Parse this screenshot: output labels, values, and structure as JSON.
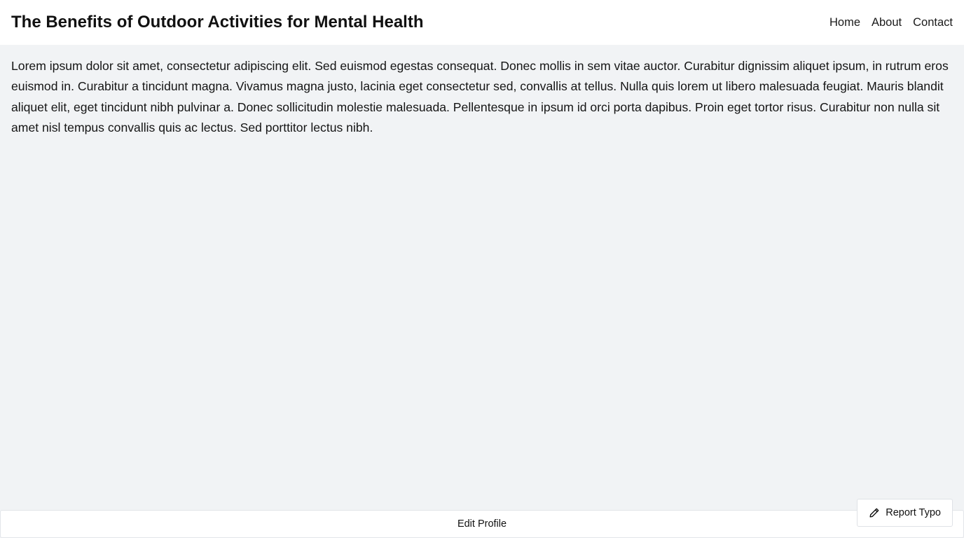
{
  "header": {
    "title": "The Benefits of Outdoor Activities for Mental Health",
    "nav": [
      "Home",
      "About",
      "Contact"
    ]
  },
  "main": {
    "body_text": "Lorem ipsum dolor sit amet, consectetur adipiscing elit. Sed euismod egestas consequat. Donec mollis in sem vitae auctor. Curabitur dignissim aliquet ipsum, in rutrum eros euismod in. Curabitur a tincidunt magna. Vivamus magna justo, lacinia eget consectetur sed, convallis at tellus. Nulla quis lorem ut libero malesuada feugiat. Mauris blandit aliquet elit, eget tincidunt nibh pulvinar a. Donec sollicitudin molestie malesuada. Pellentesque in ipsum id orci porta dapibus. Proin eget tortor risus. Curabitur non nulla sit amet nisl tempus convallis quis ac lectus. Sed porttitor lectus nibh."
  },
  "footer": {
    "edit_profile_label": "Edit Profile",
    "report_typo_label": "Report Typo",
    "report_typo_icon": "pencil-icon"
  },
  "colors": {
    "page_background": "#f1f3f5",
    "header_background": "#ffffff",
    "text": "#111111"
  }
}
